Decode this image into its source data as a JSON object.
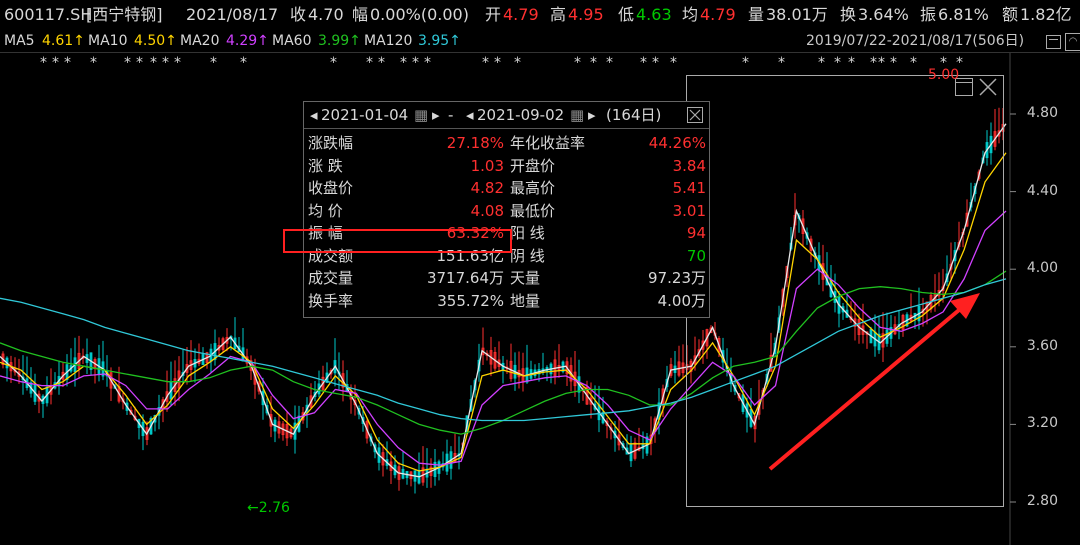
{
  "header": {
    "code": "600117.SH",
    "name": "[西宁特钢]",
    "date": "2021/08/17",
    "close_label": "收",
    "close": "4.70",
    "change_label": "幅",
    "change": "0.00%(0.00)",
    "open_label": "开",
    "open": "4.79",
    "high_label": "高",
    "high": "4.95",
    "low_label": "低",
    "low": "4.63",
    "avg_label": "均",
    "avg": "4.79",
    "volume_label": "量",
    "volume": "38.01万",
    "turnover_label": "换",
    "turnover": "3.64%",
    "amplitude_label": "振",
    "amplitude": "6.81%",
    "amount_label": "额",
    "amount": "1.82亿"
  },
  "ma_bar": {
    "ma5_label": "MA5",
    "ma5": "4.61↑",
    "ma10_label": "MA10",
    "ma10": "4.50↑",
    "ma20_label": "MA20",
    "ma20": "4.29↑",
    "ma60_label": "MA60",
    "ma60": "3.99↑",
    "ma120_label": "MA120",
    "ma120": "3.95↑",
    "range": "2019/07/22-2021/08/17(506日)"
  },
  "colors": {
    "up": "#ff3030",
    "down": "#00c800",
    "ma5": "#e8e8e8",
    "ma10": "#ffd400",
    "ma20": "#d040ff",
    "ma60": "#20c020",
    "ma120": "#30c8d8"
  },
  "popup": {
    "start_date": "2021-01-04",
    "dash": "-",
    "end_date": "2021-09-02",
    "days": "(164日)",
    "left_rows": [
      {
        "label": "涨跌幅",
        "value": "27.18%",
        "color": "red"
      },
      {
        "label": "涨  跌",
        "value": "1.03",
        "color": "red"
      },
      {
        "label": "收盘价",
        "value": "4.82",
        "color": "red"
      },
      {
        "label": "均  价",
        "value": "4.08",
        "color": "red"
      },
      {
        "label": "振  幅",
        "value": "63.32%",
        "color": "red"
      },
      {
        "label": "成交额",
        "value": "151.63亿",
        "color": "white"
      },
      {
        "label": "成交量",
        "value": "3717.64万",
        "color": "white"
      },
      {
        "label": "换手率",
        "value": "355.72%",
        "color": "white"
      }
    ],
    "right_rows": [
      {
        "label": "年化收益率",
        "value": "44.26%",
        "color": "red"
      },
      {
        "label": "开盘价",
        "value": "3.84",
        "color": "red"
      },
      {
        "label": "最高价",
        "value": "5.41",
        "color": "red"
      },
      {
        "label": "最低价",
        "value": "3.01",
        "color": "red"
      },
      {
        "label": "阳  线",
        "value": "94",
        "color": "red"
      },
      {
        "label": "阴  线",
        "value": "70",
        "color": "green"
      },
      {
        "label": "天量",
        "value": "97.23万",
        "color": "white"
      },
      {
        "label": "地量",
        "value": "4.00万",
        "color": "white"
      }
    ]
  },
  "annotations": {
    "low_marker": "←2.76",
    "high_marker": "5.00"
  },
  "chart_data": {
    "type": "line",
    "y_ticks": [
      4.8,
      4.4,
      4.0,
      3.6,
      3.2,
      2.8
    ],
    "y_tick_labels": [
      "4.80",
      "4.40",
      "4.00",
      "3.60",
      "3.20",
      "2.80"
    ],
    "ylim": [
      2.72,
      5.02
    ],
    "x_range": [
      "2019/07/22",
      "2021/08/17"
    ],
    "bars": 506,
    "series": [
      {
        "name": "MA5",
        "values": [
          3.55,
          3.45,
          3.32,
          3.45,
          3.55,
          3.48,
          3.3,
          3.15,
          3.35,
          3.5,
          3.55,
          3.65,
          3.5,
          3.2,
          3.15,
          3.35,
          3.5,
          3.3,
          3.05,
          2.95,
          2.93,
          2.98,
          3.05,
          3.58,
          3.5,
          3.45,
          3.48,
          3.5,
          3.35,
          3.2,
          3.05,
          3.1,
          3.48,
          3.5,
          3.7,
          3.4,
          3.2,
          3.6,
          4.3,
          4.05,
          3.82,
          3.7,
          3.62,
          3.72,
          3.78,
          3.9,
          4.2,
          4.6,
          4.75
        ]
      },
      {
        "name": "MA10",
        "values": [
          3.52,
          3.48,
          3.38,
          3.42,
          3.5,
          3.48,
          3.35,
          3.2,
          3.3,
          3.45,
          3.52,
          3.6,
          3.52,
          3.28,
          3.18,
          3.3,
          3.45,
          3.35,
          3.12,
          3.0,
          2.96,
          2.98,
          3.03,
          3.45,
          3.48,
          3.45,
          3.47,
          3.48,
          3.38,
          3.24,
          3.1,
          3.1,
          3.38,
          3.48,
          3.62,
          3.45,
          3.25,
          3.5,
          4.15,
          4.05,
          3.88,
          3.75,
          3.65,
          3.7,
          3.76,
          3.85,
          4.1,
          4.45,
          4.6
        ]
      },
      {
        "name": "MA20",
        "values": [
          3.45,
          3.42,
          3.4,
          3.4,
          3.45,
          3.46,
          3.4,
          3.28,
          3.28,
          3.38,
          3.46,
          3.55,
          3.52,
          3.35,
          3.23,
          3.26,
          3.38,
          3.36,
          3.2,
          3.08,
          3.0,
          2.99,
          3.01,
          3.3,
          3.4,
          3.42,
          3.44,
          3.45,
          3.4,
          3.3,
          3.17,
          3.12,
          3.28,
          3.4,
          3.52,
          3.45,
          3.3,
          3.4,
          3.9,
          4.0,
          3.92,
          3.8,
          3.7,
          3.68,
          3.72,
          3.78,
          3.95,
          4.2,
          4.3
        ]
      },
      {
        "name": "MA60",
        "values": [
          3.62,
          3.58,
          3.55,
          3.52,
          3.5,
          3.48,
          3.46,
          3.44,
          3.42,
          3.42,
          3.44,
          3.48,
          3.5,
          3.48,
          3.42,
          3.38,
          3.36,
          3.34,
          3.3,
          3.25,
          3.2,
          3.17,
          3.15,
          3.18,
          3.22,
          3.27,
          3.32,
          3.36,
          3.38,
          3.38,
          3.35,
          3.3,
          3.3,
          3.36,
          3.44,
          3.5,
          3.52,
          3.55,
          3.68,
          3.8,
          3.86,
          3.9,
          3.91,
          3.9,
          3.88,
          3.87,
          3.88,
          3.92,
          3.99
        ]
      },
      {
        "name": "MA120",
        "values": [
          3.85,
          3.83,
          3.8,
          3.77,
          3.74,
          3.7,
          3.67,
          3.64,
          3.61,
          3.58,
          3.56,
          3.54,
          3.52,
          3.5,
          3.47,
          3.44,
          3.41,
          3.38,
          3.35,
          3.31,
          3.28,
          3.25,
          3.23,
          3.22,
          3.22,
          3.22,
          3.23,
          3.24,
          3.25,
          3.26,
          3.27,
          3.29,
          3.31,
          3.34,
          3.38,
          3.42,
          3.46,
          3.5,
          3.56,
          3.62,
          3.68,
          3.72,
          3.76,
          3.79,
          3.82,
          3.85,
          3.88,
          3.92,
          3.95
        ]
      }
    ],
    "zoom_box": {
      "from": "2021/01/04",
      "to": "2021/08/17"
    }
  }
}
